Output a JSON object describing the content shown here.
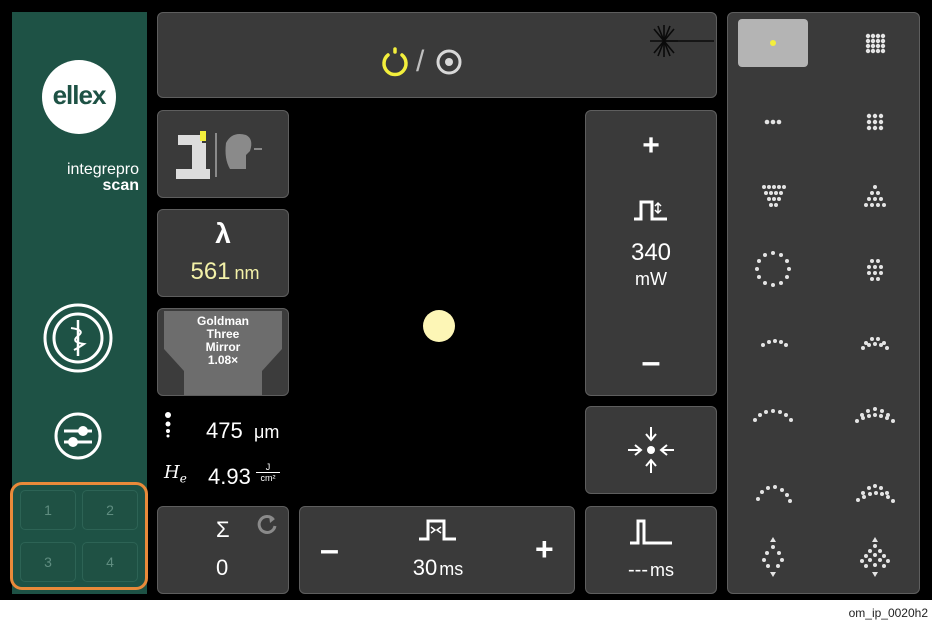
{
  "brand": {
    "logo_text": "ellex",
    "product_line1": "integrepro",
    "product_line2": "scan"
  },
  "memory_keys": [
    "1",
    "2",
    "3",
    "4"
  ],
  "status": {
    "mode_separator": "/"
  },
  "wavelength": {
    "symbol": "λ",
    "value": "561",
    "unit": "nm"
  },
  "lens": {
    "line1": "Goldman",
    "line2": "Three",
    "line3": "Mirror",
    "line4": "1.08×"
  },
  "spot_size": {
    "value": "475",
    "unit": "μm"
  },
  "fluence": {
    "symbol_main": "H",
    "symbol_sub": "e",
    "value": "4.93",
    "unit_top": "J",
    "unit_bottom": "cm²"
  },
  "power": {
    "plus": "+",
    "minus": "–",
    "value": "340",
    "unit": "mW"
  },
  "counter": {
    "symbol": "Σ",
    "value": "0"
  },
  "pulse_duration": {
    "minus": "–",
    "plus": "+",
    "value": "30",
    "unit": "ms"
  },
  "interval": {
    "value": "---",
    "unit": "ms"
  },
  "footer": {
    "image_code": "om_ip_0020h2"
  },
  "colors": {
    "sidebar_green": "#1e5245",
    "panel_grey": "#3a3a3a",
    "accent_yellow": "#f3ef3c",
    "aim_beam": "#fdf6b6",
    "memory_highlight": "#e98a3a"
  },
  "patterns": [
    "single-spot",
    "square-grid-large",
    "line-3",
    "square-grid-3x3",
    "triangle-inverted",
    "triangle",
    "circle",
    "hexagon",
    "line-arc",
    "double-arc",
    "arc-upper",
    "arc-upper-double",
    "arc-large",
    "arc-large-double",
    "octant",
    "octant-double"
  ],
  "selected_pattern": "single-spot"
}
